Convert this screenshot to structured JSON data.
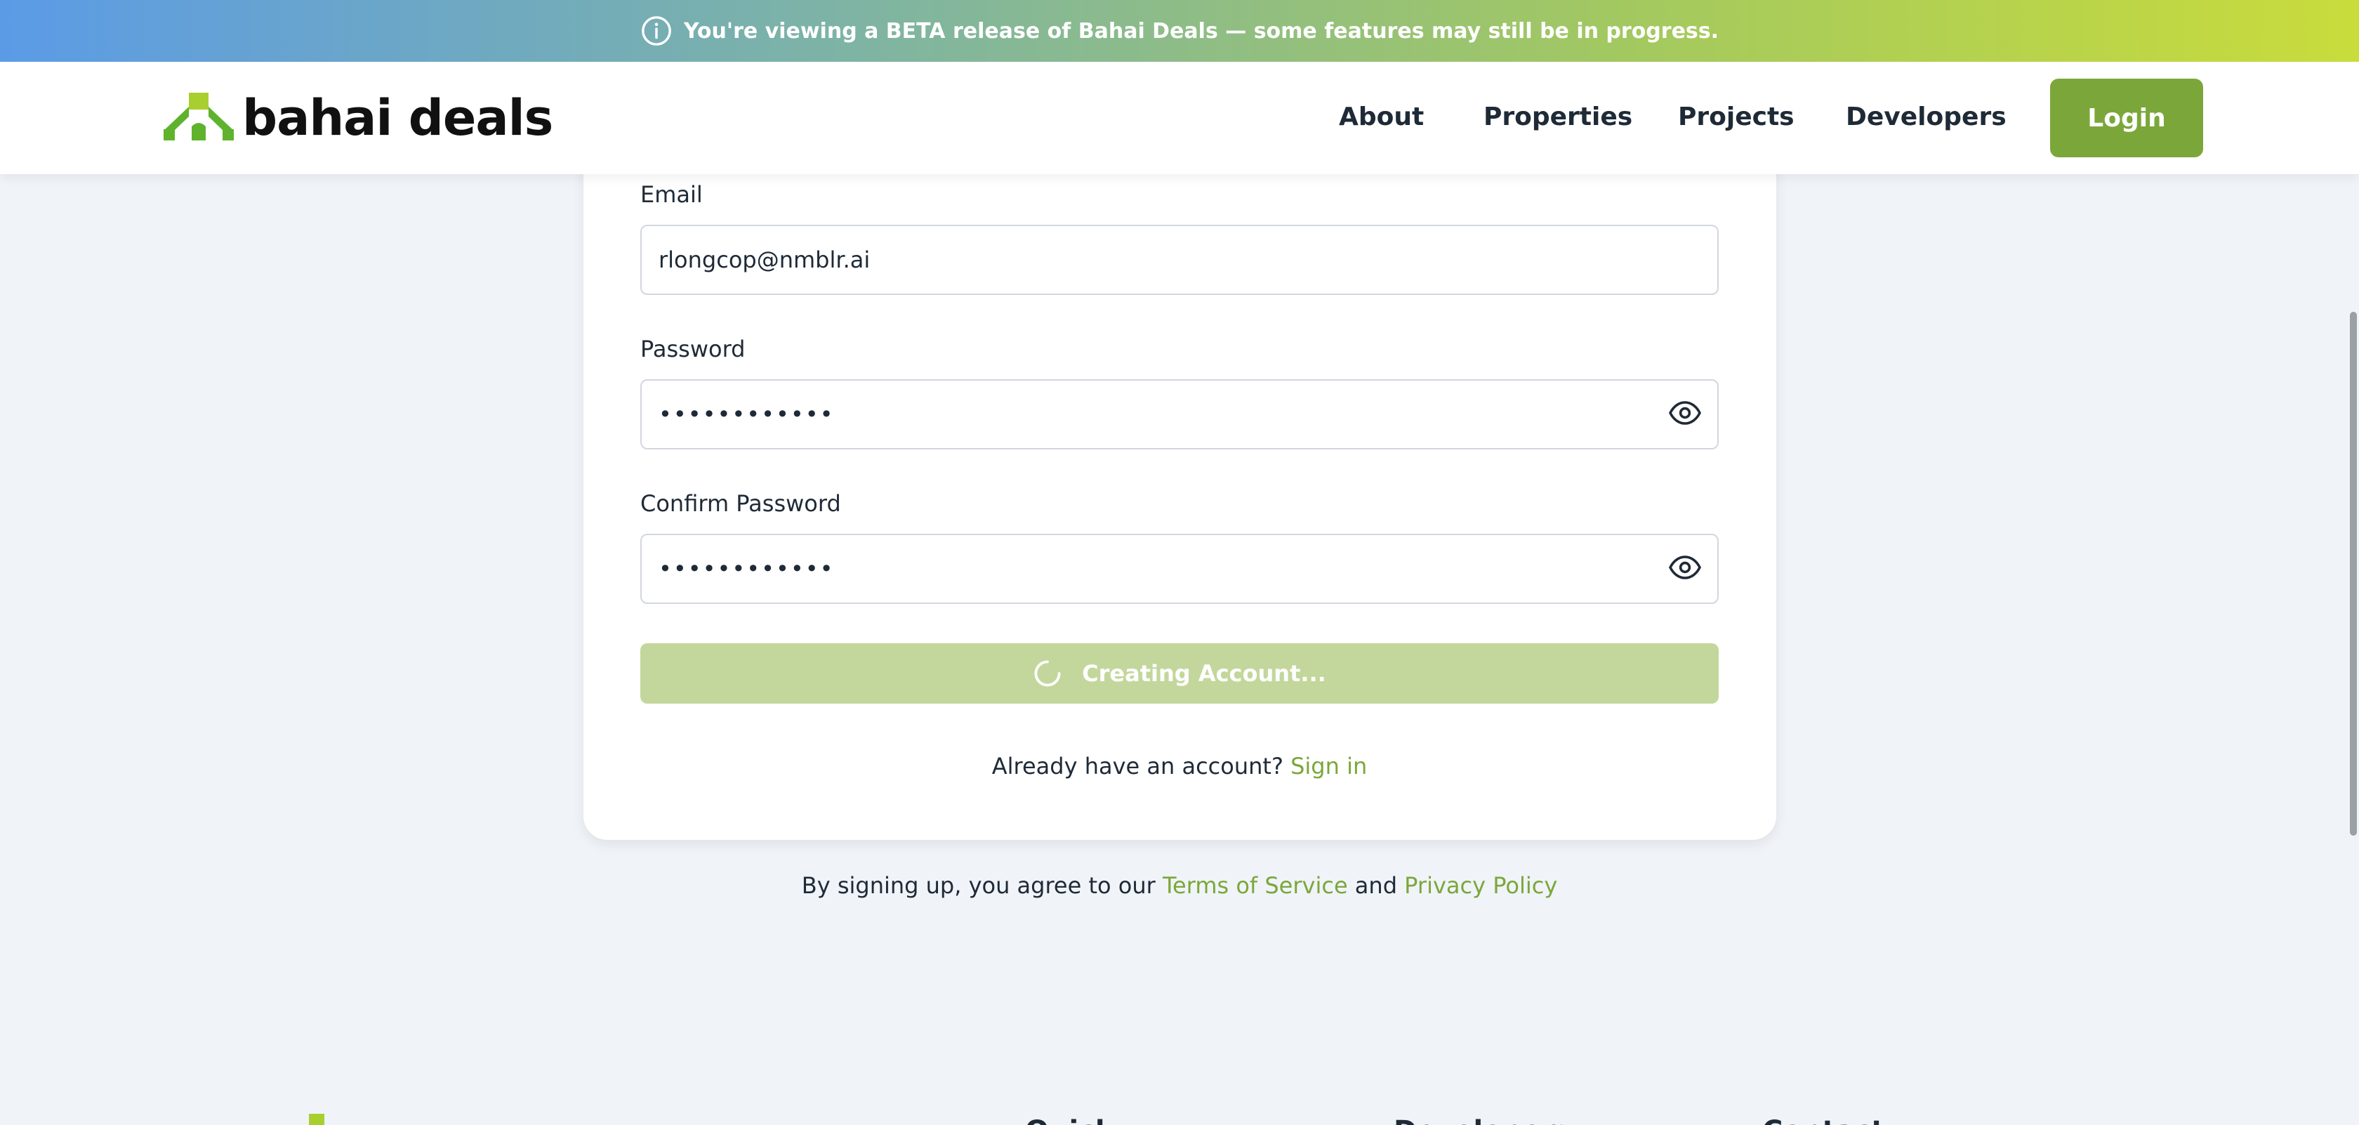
{
  "banner": {
    "text": "You're viewing a BETA release of Bahai Deals — some features may still be in progress.",
    "icon": "info-icon"
  },
  "header": {
    "logo_text": "bahai deals",
    "nav": [
      {
        "label": "About"
      },
      {
        "label": "Properties"
      },
      {
        "label": "Projects"
      },
      {
        "label": "Developers"
      }
    ],
    "login_label": "Login"
  },
  "form": {
    "email_label": "Email",
    "email_value": "rlongcop@nmblr.ai",
    "password_label": "Password",
    "password_value": "••••••••••••",
    "confirm_label": "Confirm Password",
    "confirm_value": "••••••••••••",
    "submit_label": "Creating Account...",
    "signin_prompt": "Already have an account?",
    "signin_link": "Sign in"
  },
  "legal": {
    "prefix": "By signing up, you agree to our",
    "terms": "Terms of Service",
    "and": "and",
    "privacy": "Privacy Policy"
  },
  "footer": {
    "headings": [
      "Quick Links",
      "Developers",
      "Contact Us"
    ]
  },
  "colors": {
    "accent": "#7ba73a",
    "button_disabled": "#c3d79c",
    "page_bg": "#f0f3f8"
  }
}
